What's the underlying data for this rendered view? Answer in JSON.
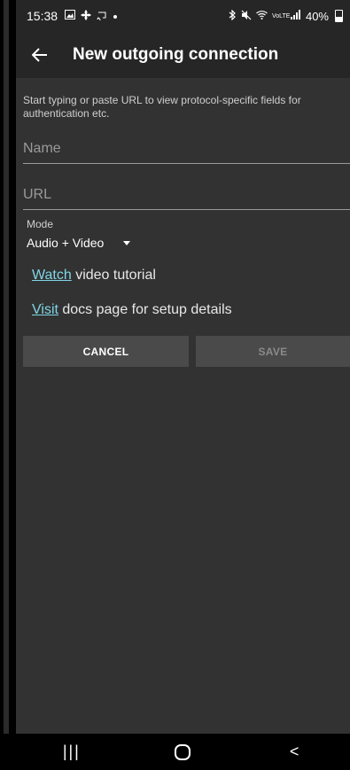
{
  "status_bar": {
    "time": "15:38",
    "left_icons": [
      "image-icon",
      "fan-icon",
      "cast-icon",
      "dot-icon"
    ],
    "network_label": "VoLTE",
    "battery": "40%"
  },
  "app_bar": {
    "title": "New outgoing connection"
  },
  "form": {
    "hint": "Start typing or paste URL to view protocol-specific fields for authentication etc.",
    "name_placeholder": "Name",
    "url_placeholder": "URL",
    "name_value": "",
    "url_value": "",
    "mode_label": "Mode",
    "mode_value": "Audio + Video",
    "watch_link": "Watch",
    "watch_rest": " video tutorial",
    "visit_link": "Visit",
    "visit_rest": " docs page for setup details",
    "cancel_label": "CANCEL",
    "save_label": "SAVE"
  },
  "colors": {
    "background": "#323232",
    "bar": "#262626",
    "link": "#7fd6e6",
    "button": "#4a4a4a"
  },
  "nav_bar": {
    "recent_glyph": "|||",
    "back_glyph": "<"
  }
}
